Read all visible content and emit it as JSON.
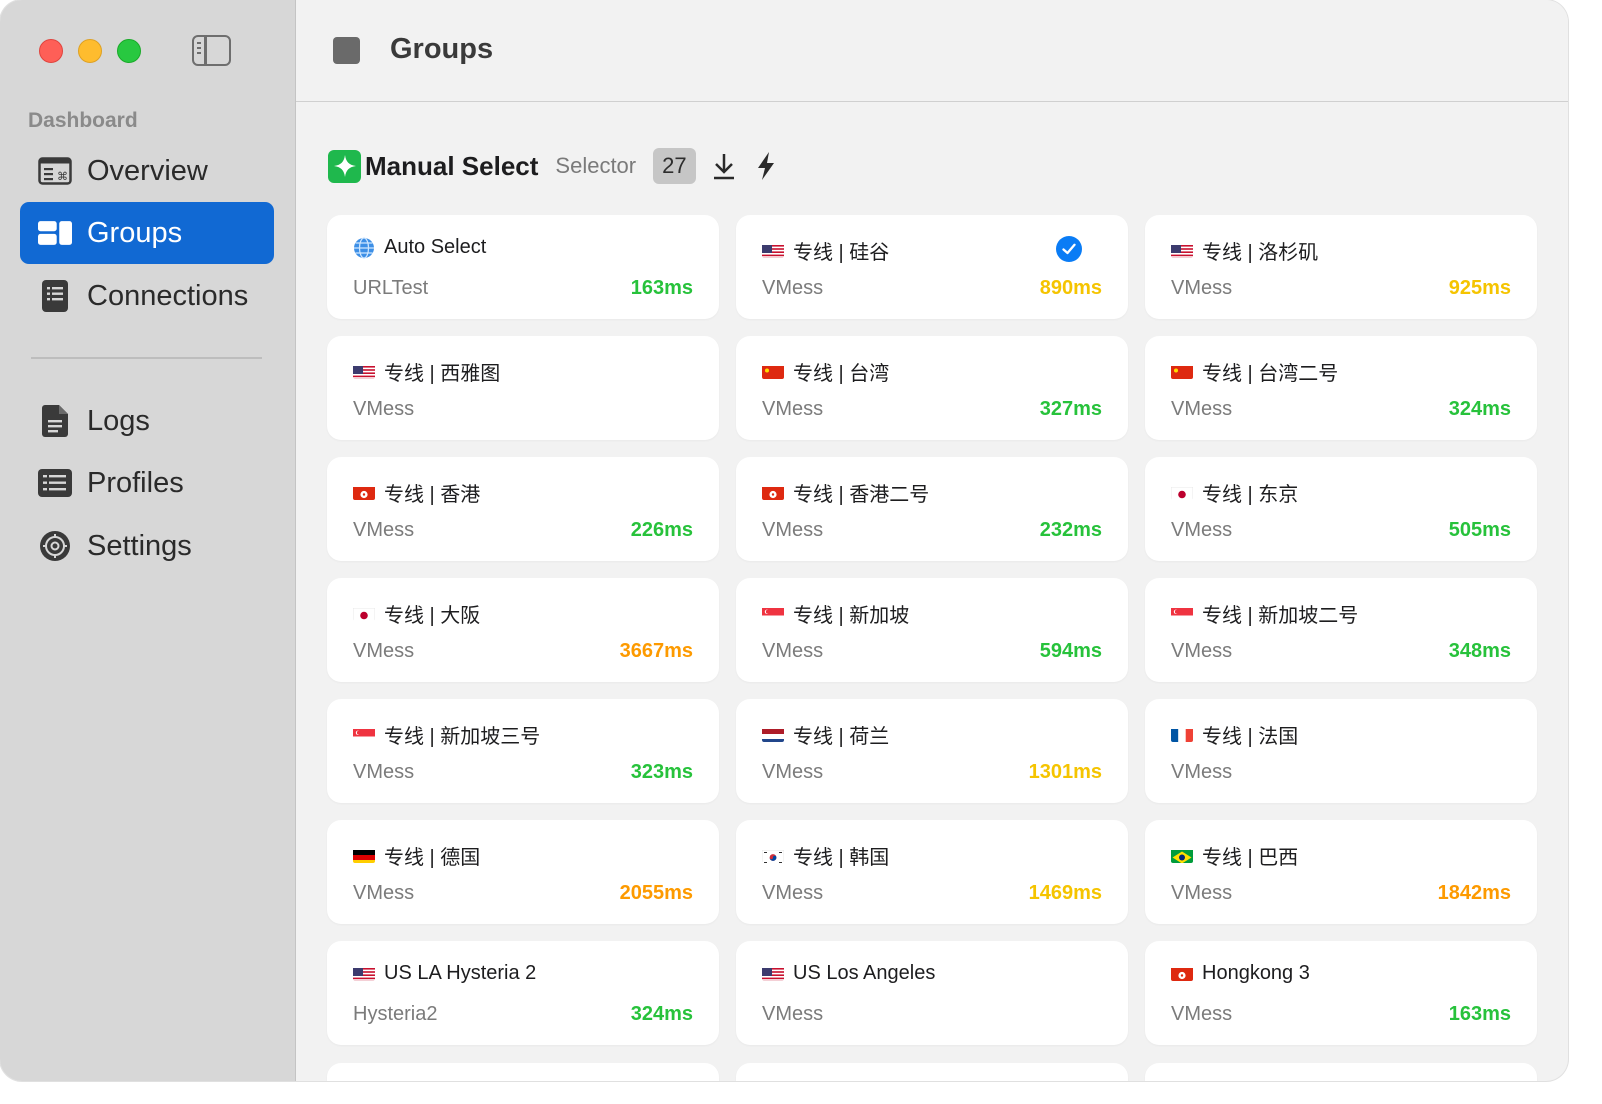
{
  "sidebar": {
    "section_label": "Dashboard",
    "items": [
      {
        "label": "Overview",
        "icon": "overview-icon",
        "active": false
      },
      {
        "label": "Groups",
        "icon": "groups-icon",
        "active": true
      },
      {
        "label": "Connections",
        "icon": "connections-icon",
        "active": false
      },
      {
        "label": "Logs",
        "icon": "logs-icon",
        "active": false
      },
      {
        "label": "Profiles",
        "icon": "profiles-icon",
        "active": false
      },
      {
        "label": "Settings",
        "icon": "settings-icon",
        "active": false
      }
    ]
  },
  "toolbar": {
    "title": "Groups"
  },
  "group": {
    "name": "Manual Select",
    "type": "Selector",
    "count": "27"
  },
  "colors": {
    "accent": "#1169d3",
    "delay_good": "#27c23b",
    "delay_medium": "#f5c400",
    "delay_slow": "#fd9a00"
  },
  "proxies": [
    {
      "name": "Auto Select",
      "flag": "globe",
      "protocol": "URLTest",
      "delay": "163ms",
      "level": "green",
      "selected": false
    },
    {
      "name": "专线 | 硅谷",
      "flag": "us",
      "protocol": "VMess",
      "delay": "890ms",
      "level": "yellow",
      "selected": true
    },
    {
      "name": "专线 | 洛杉矶",
      "flag": "us",
      "protocol": "VMess",
      "delay": "925ms",
      "level": "yellow",
      "selected": false
    },
    {
      "name": "专线 | 西雅图",
      "flag": "us",
      "protocol": "VMess",
      "delay": "",
      "level": "green",
      "selected": false
    },
    {
      "name": "专线 | 台湾",
      "flag": "cn",
      "protocol": "VMess",
      "delay": "327ms",
      "level": "green",
      "selected": false
    },
    {
      "name": "专线 | 台湾二号",
      "flag": "cn",
      "protocol": "VMess",
      "delay": "324ms",
      "level": "green",
      "selected": false
    },
    {
      "name": "专线 | 香港",
      "flag": "hk",
      "protocol": "VMess",
      "delay": "226ms",
      "level": "green",
      "selected": false
    },
    {
      "name": "专线 | 香港二号",
      "flag": "hk",
      "protocol": "VMess",
      "delay": "232ms",
      "level": "green",
      "selected": false
    },
    {
      "name": "专线 | 东京",
      "flag": "jp",
      "protocol": "VMess",
      "delay": "505ms",
      "level": "green",
      "selected": false
    },
    {
      "name": "专线 | 大阪",
      "flag": "jp",
      "protocol": "VMess",
      "delay": "3667ms",
      "level": "orange",
      "selected": false
    },
    {
      "name": "专线 | 新加坡",
      "flag": "sg",
      "protocol": "VMess",
      "delay": "594ms",
      "level": "green",
      "selected": false
    },
    {
      "name": "专线 | 新加坡二号",
      "flag": "sg",
      "protocol": "VMess",
      "delay": "348ms",
      "level": "green",
      "selected": false
    },
    {
      "name": "专线 | 新加坡三号",
      "flag": "sg",
      "protocol": "VMess",
      "delay": "323ms",
      "level": "green",
      "selected": false
    },
    {
      "name": "专线 | 荷兰",
      "flag": "nl",
      "protocol": "VMess",
      "delay": "1301ms",
      "level": "yellow",
      "selected": false
    },
    {
      "name": "专线 | 法国",
      "flag": "fr",
      "protocol": "VMess",
      "delay": "",
      "level": "green",
      "selected": false
    },
    {
      "name": "专线 | 德国",
      "flag": "de",
      "protocol": "VMess",
      "delay": "2055ms",
      "level": "orange",
      "selected": false
    },
    {
      "name": "专线 | 韩国",
      "flag": "kr",
      "protocol": "VMess",
      "delay": "1469ms",
      "level": "yellow",
      "selected": false
    },
    {
      "name": "专线 | 巴西",
      "flag": "br",
      "protocol": "VMess",
      "delay": "1842ms",
      "level": "orange",
      "selected": false
    },
    {
      "name": "US LA Hysteria 2",
      "flag": "us",
      "protocol": "Hysteria2",
      "delay": "324ms",
      "level": "green",
      "selected": false
    },
    {
      "name": "US Los Angeles",
      "flag": "us",
      "protocol": "VMess",
      "delay": "",
      "level": "green",
      "selected": false
    },
    {
      "name": "Hongkong 3",
      "flag": "hk",
      "protocol": "VMess",
      "delay": "163ms",
      "level": "green",
      "selected": false
    }
  ]
}
